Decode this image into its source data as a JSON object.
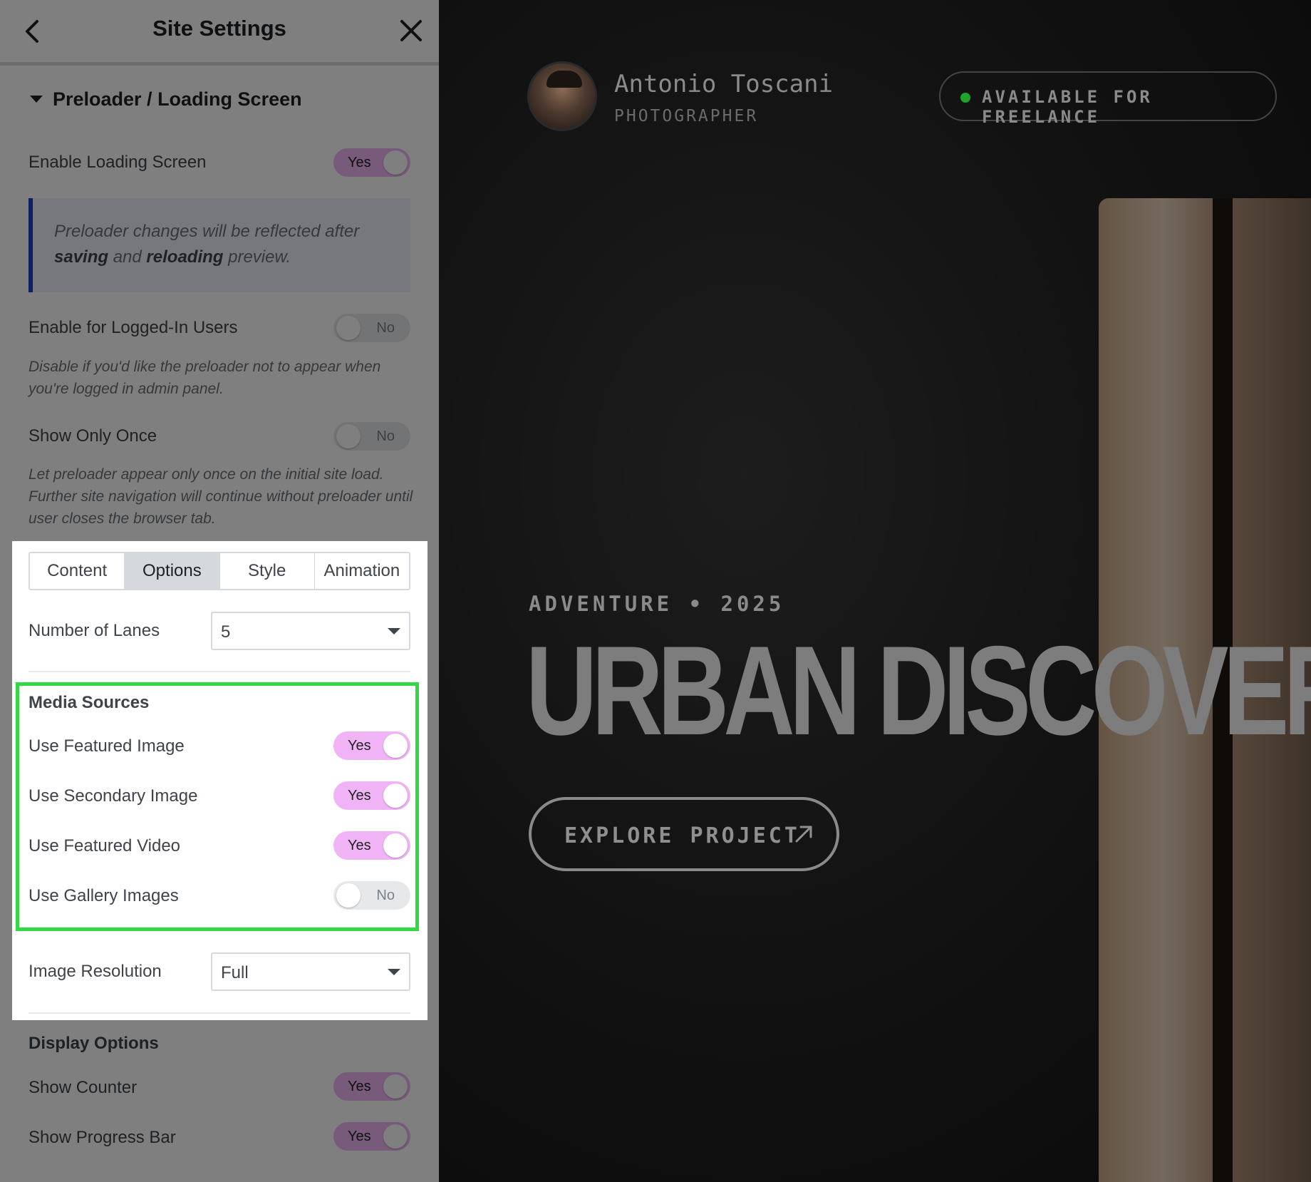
{
  "panel": {
    "title": "Site Settings",
    "section_title": "Preloader / Loading Screen",
    "enable_loading": {
      "label": "Enable Loading Screen",
      "state": "Yes"
    },
    "notice": {
      "before": "Preloader changes will be reflected after",
      "strong1": "saving",
      "mid": "and",
      "strong2": "reloading",
      "after": "preview."
    },
    "logged_in": {
      "label": "Enable for Logged-In Users",
      "state": "No",
      "help": "Disable if you'd like the preloader not to appear when you're logged in admin panel."
    },
    "show_once": {
      "label": "Show Only Once",
      "state": "No",
      "help": "Let preloader appear only once on the initial site load. Further site navigation will continue without preloader until user closes the browser tab."
    },
    "tabs": [
      "Content",
      "Options",
      "Style",
      "Animation"
    ],
    "active_tab": "Options",
    "lanes": {
      "label": "Number of Lanes",
      "value": "5"
    },
    "media_sources": {
      "title": "Media Sources",
      "featured_image": {
        "label": "Use Featured Image",
        "state": "Yes"
      },
      "secondary_image": {
        "label": "Use Secondary Image",
        "state": "Yes"
      },
      "featured_video": {
        "label": "Use Featured Video",
        "state": "Yes"
      },
      "gallery_images": {
        "label": "Use Gallery Images",
        "state": "No"
      }
    },
    "resolution": {
      "label": "Image Resolution",
      "value": "Full"
    },
    "display_options": {
      "title": "Display Options",
      "show_counter": {
        "label": "Show Counter",
        "state": "Yes"
      },
      "show_progress": {
        "label": "Show Progress Bar",
        "state": "Yes"
      }
    }
  },
  "preview": {
    "name": "Antonio Toscani",
    "role": "PHOTOGRAPHER",
    "availability": "AVAILABLE FOR FREELANCE",
    "eyebrow": "ADVENTURE • 2025",
    "headline": "URBAN DISCOVERIES",
    "cta": "EXPLORE PROJECT"
  },
  "colors": {
    "toggle_on": "#f0b4f6",
    "highlight_frame": "#34d845",
    "notice_accent": "#1e3fc9",
    "status_dot": "#20a32b"
  }
}
